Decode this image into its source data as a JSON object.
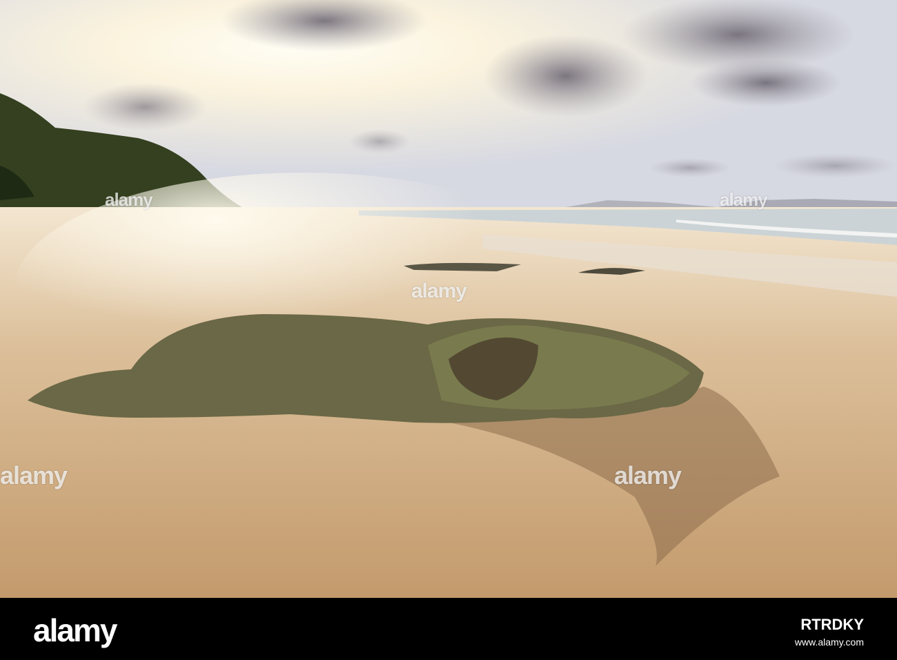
{
  "photo": {
    "subject": "sunset-beach-rock",
    "colors": {
      "sky_glow": "#fffbe8",
      "sky_blue": "#d9dde6",
      "cloud": "#6f6a76",
      "hill": "#2f3a1f",
      "sea": "#c9d1d3",
      "sand": "#c9a479",
      "sand_dark": "#9e7a56",
      "rock": "#5d5a3e"
    },
    "watermark_text": "alamy"
  },
  "footer": {
    "logo": "alamy",
    "image_id": "RTRDKY",
    "site": "www.alamy.com"
  }
}
